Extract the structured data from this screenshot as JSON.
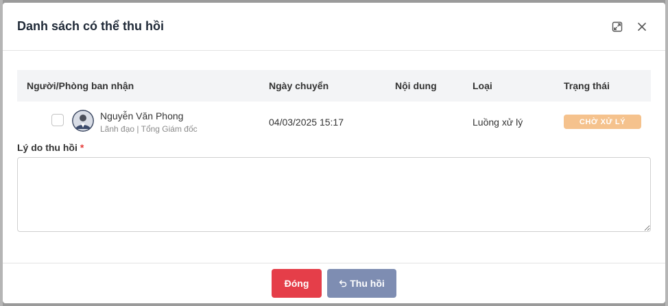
{
  "dialog": {
    "title": "Danh sách có thể thu hồi"
  },
  "table": {
    "columns": [
      "Người/Phòng ban nhận",
      "Ngày chuyển",
      "Nội dung",
      "Loại",
      "Trạng thái"
    ],
    "rows": [
      {
        "name": "Nguyễn Văn Phong",
        "subtitle": "Lãnh đạo | Tổng Giám đốc",
        "date": "04/03/2025 15:17",
        "content": "",
        "type": "Luồng xử lý",
        "status": "CHỜ XỬ LÝ",
        "checked": false
      }
    ]
  },
  "form": {
    "reason_label": "Lý do thu hồi",
    "required_mark": "*",
    "reason_value": ""
  },
  "footer": {
    "close_label": "Đóng",
    "recall_label": "Thu hồi"
  },
  "colors": {
    "status_badge": "#f5c28d",
    "close_button": "#e53e49",
    "recall_button": "#7e8db2",
    "required": "#e53935"
  },
  "icons": {
    "expand": "expand-icon",
    "close": "close-icon",
    "recall": "undo-icon"
  }
}
